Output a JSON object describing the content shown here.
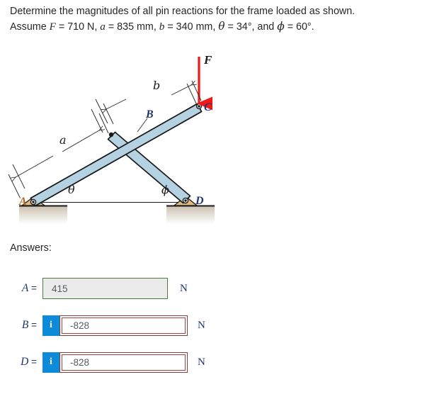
{
  "problem": {
    "line1": "Determine the magnitudes of all pin reactions for the frame loaded as shown.",
    "line2_prefix": "Assume ",
    "force_symbol": "F",
    "force_value": " = 710 N, ",
    "a_symbol": "a",
    "a_value": " = 835 mm, ",
    "b_symbol": "b",
    "b_value": " = 340 mm, ",
    "theta_symbol": "θ",
    "theta_value": " =  34°, and ",
    "phi_symbol": "ϕ",
    "phi_value": " =  60°."
  },
  "figure": {
    "label_A": "A",
    "label_B": "B",
    "label_C": "C",
    "label_D": "D",
    "label_F": "F",
    "label_a": "a",
    "label_b": "b",
    "label_theta": "θ",
    "label_phi": "ϕ",
    "colors": {
      "member_fill": "#b4d2e2",
      "member_stroke": "#1a1a1a",
      "support_fill": "#e2b97f",
      "force_arrow": "#f01818",
      "label_color": "#22356f",
      "dimension_line": "#2b2b2b",
      "ground_top": "#cbbfae",
      "ground_bottom": "#ffffff"
    }
  },
  "answers": {
    "heading": "Answers:",
    "rows": [
      {
        "label": "A",
        "equals": " =",
        "value": "415",
        "unit": "N",
        "state": "correct",
        "has_info": false,
        "info_icon": "i"
      },
      {
        "label": "B",
        "equals": " =",
        "value": "-828",
        "unit": "N",
        "state": "incorrect",
        "has_info": true,
        "info_icon": "i"
      },
      {
        "label": "D",
        "equals": " =",
        "value": "-828",
        "unit": "N",
        "state": "incorrect",
        "has_info": true,
        "info_icon": "i"
      }
    ]
  }
}
